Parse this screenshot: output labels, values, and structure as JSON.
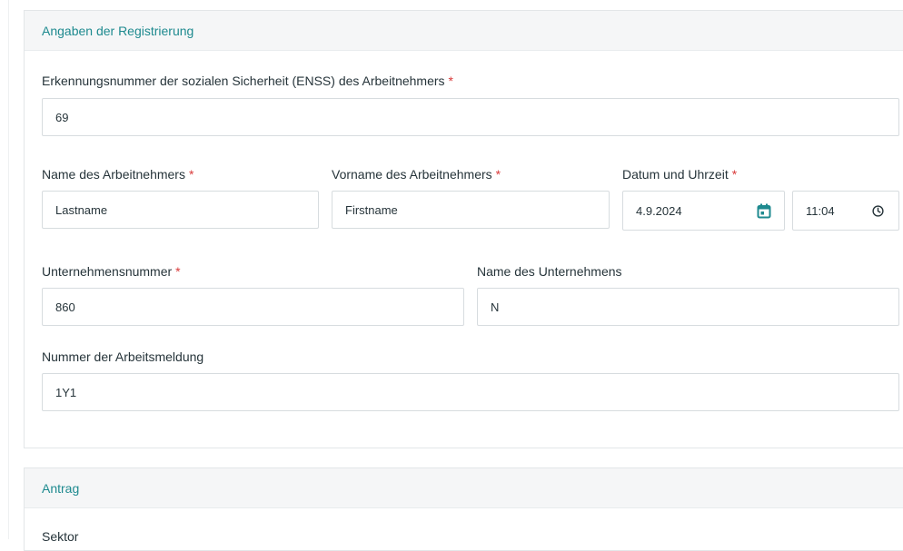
{
  "registration": {
    "header": "Angaben der Registrierung",
    "enss_label": "Erkennungsnummer der sozialen Sicherheit (ENSS) des Arbeitnehmers",
    "enss_value": "69",
    "lastname_label": "Name des Arbeitnehmers",
    "lastname_value": "Lastname",
    "firstname_label": "Vorname des Arbeitnehmers",
    "firstname_value": "Firstname",
    "datetime_label": "Datum und Uhrzeit",
    "date_value": "4.9.2024",
    "time_value": "11:04",
    "company_number_label": "Unternehmensnummer",
    "company_number_value": "860",
    "company_name_label": "Name des Unternehmens",
    "company_name_value": "N",
    "work_notice_label": "Nummer der Arbeitsmeldung",
    "work_notice_value": "1Y1",
    "required_marker": "*"
  },
  "application": {
    "header": "Antrag",
    "sector_label": "Sektor"
  },
  "icons": {
    "calendar": "calendar-icon",
    "clock": "clock-icon"
  },
  "colors": {
    "accent": "#1e8a8f",
    "required": "#d93a3a"
  }
}
